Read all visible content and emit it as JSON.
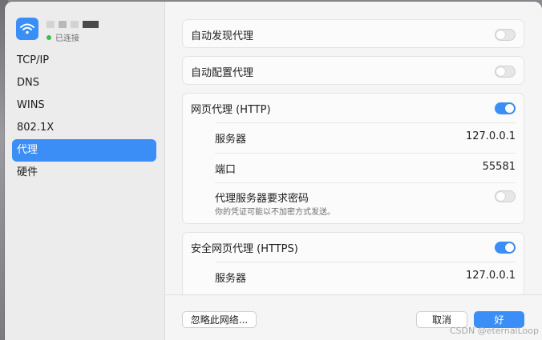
{
  "network": {
    "status": "已连接"
  },
  "sidebar": {
    "items": [
      {
        "label": "TCP/IP"
      },
      {
        "label": "DNS"
      },
      {
        "label": "WINS"
      },
      {
        "label": "802.1X"
      },
      {
        "label": "代理"
      },
      {
        "label": "硬件"
      }
    ],
    "selected": "代理"
  },
  "proxies": {
    "auto_discover": {
      "label": "自动发现代理",
      "enabled": false
    },
    "auto_config": {
      "label": "自动配置代理",
      "enabled": false
    },
    "http": {
      "label": "网页代理 (HTTP)",
      "enabled": true,
      "server_label": "服务器",
      "server": "127.0.0.1",
      "port_label": "端口",
      "port": "55581",
      "password_label": "代理服务器要求密码",
      "password_enabled": false,
      "password_note": "你的凭证可能以不加密方式发送。"
    },
    "https": {
      "label": "安全网页代理 (HTTPS)",
      "enabled": true,
      "server_label": "服务器",
      "server": "127.0.0.1"
    }
  },
  "footer": {
    "ignore_label": "忽略此网络...",
    "cancel_label": "取消",
    "ok_label": "好"
  },
  "watermark": "CSDN @eternalLoop",
  "colors": {
    "accent": "#3b8ef6",
    "connected": "#32c24d"
  }
}
